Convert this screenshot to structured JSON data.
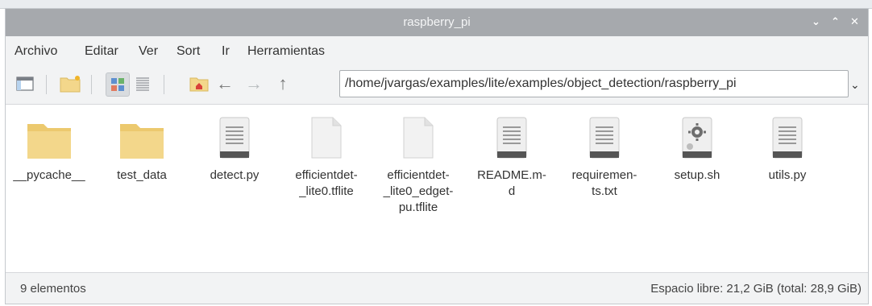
{
  "window": {
    "title": "raspberry_pi",
    "controls": {
      "minimize": "⌄",
      "maximize": "⌃",
      "close": "✕"
    }
  },
  "menu": [
    "Archivo",
    "Editar",
    "Ver",
    "Sort",
    "Ir",
    "Herramientas"
  ],
  "toolbar": {
    "buttons": [
      "new-tab-icon",
      "new-folder-icon",
      "icon-view-icon",
      "list-view-icon",
      "home-icon",
      "back-arrow-icon",
      "forward-arrow-icon",
      "up-arrow-icon"
    ],
    "path": "/home/jvargas/examples/lite/examples/object_detection/raspberry_pi",
    "path_dropdown": "⌄"
  },
  "files": [
    {
      "name": "__pycache__",
      "kind": "folder"
    },
    {
      "name": "test_data",
      "kind": "folder"
    },
    {
      "name": "detect.py",
      "kind": "text"
    },
    {
      "name": "efficientdet-_lite0.tflite",
      "kind": "blank"
    },
    {
      "name": "efficientdet-_lite0_edgetpu.tflite",
      "kind": "blank"
    },
    {
      "name": "README.md",
      "kind": "text"
    },
    {
      "name": "requirements.txt",
      "kind": "text"
    },
    {
      "name": "setup.sh",
      "kind": "script"
    },
    {
      "name": "utils.py",
      "kind": "text"
    }
  ],
  "labels": {
    "f0": "__pycache__",
    "f1": "test_data",
    "f2": "detect.py",
    "f3": "efficientdet-\n_lite0.tflite",
    "f4": "efficientdet-\n_lite0_edget-\npu.tflite",
    "f5": "README.m-\nd",
    "f6": "requiremen-\nts.txt",
    "f7": "setup.sh",
    "f8": "utils.py"
  },
  "status": {
    "count": "9 elementos",
    "space": "Espacio libre: 21,2 GiB (total: 28,9 GiB)"
  },
  "colors": {
    "titlebar": "#a6a9ad",
    "folder": "#f3d78b",
    "accent": "#4a90d9"
  }
}
